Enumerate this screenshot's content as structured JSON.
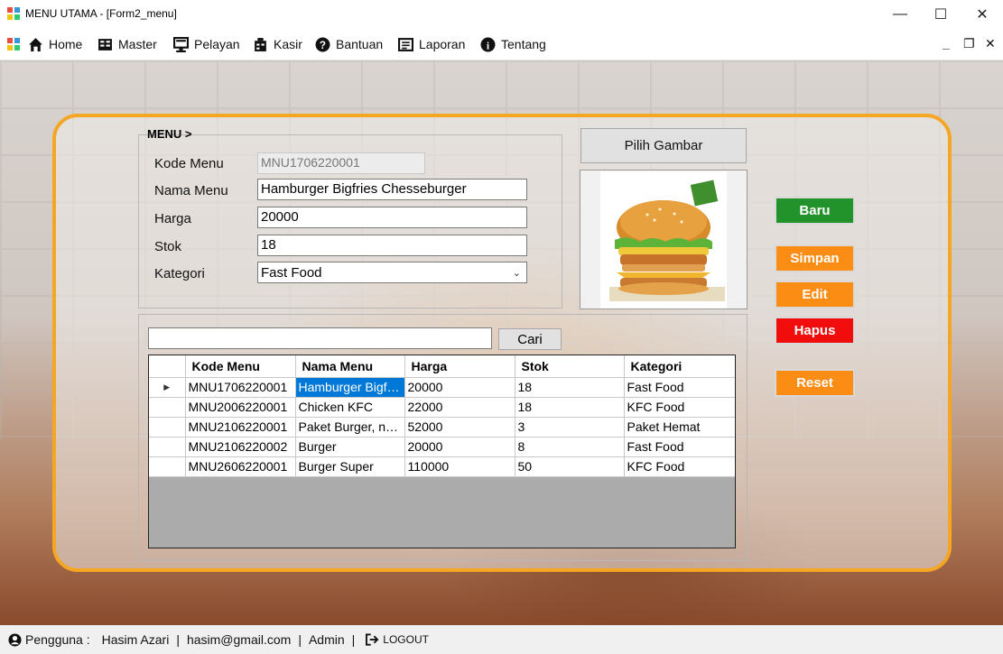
{
  "window": {
    "title": "MENU UTAMA - [Form2_menu]",
    "minimize": "—",
    "maximize": "☐",
    "close": "✕"
  },
  "menubar": {
    "items": [
      {
        "label": "Home",
        "icon": "home-icon"
      },
      {
        "label": "Master",
        "icon": "master-icon"
      },
      {
        "label": "Pelayan",
        "icon": "pelayan-icon"
      },
      {
        "label": "Kasir",
        "icon": "kasir-icon"
      },
      {
        "label": "Bantuan",
        "icon": "help-icon"
      },
      {
        "label": "Laporan",
        "icon": "report-icon"
      },
      {
        "label": "Tentang",
        "icon": "info-icon"
      }
    ],
    "mdi_minimize": "_",
    "mdi_restore": "❐",
    "mdi_close": "✕"
  },
  "form": {
    "group_title": "MENU >",
    "kode_label": "Kode Menu",
    "kode_value": "MNU1706220001",
    "nama_label": "Nama Menu",
    "nama_value": "Hamburger Bigfries Chesseburger",
    "harga_label": "Harga",
    "harga_value": "20000",
    "stok_label": "Stok",
    "stok_value": "18",
    "kategori_label": "Kategori",
    "kategori_value": "Fast Food"
  },
  "image": {
    "pilih_label": "Pilih Gambar"
  },
  "actions": {
    "baru": "Baru",
    "simpan": "Simpan",
    "edit": "Edit",
    "hapus": "Hapus",
    "reset": "Reset",
    "colors": {
      "baru": "#22922a",
      "simpan": "#fb8c14",
      "edit": "#fb8c14",
      "hapus": "#f20d0d",
      "reset": "#fb8c14"
    }
  },
  "search": {
    "value": "",
    "button": "Cari"
  },
  "grid": {
    "columns": [
      "Kode Menu",
      "Nama Menu",
      "Harga",
      "Stok",
      "Kategori"
    ],
    "rows": [
      [
        "MNU1706220001",
        "Hamburger Bigfri...",
        "20000",
        "18",
        "Fast Food"
      ],
      [
        "MNU2006220001",
        "Chicken KFC",
        "22000",
        "18",
        "KFC Food"
      ],
      [
        "MNU2106220001",
        "Paket Burger, nu...",
        "52000",
        "3",
        "Paket Hemat"
      ],
      [
        "MNU2106220002",
        "Burger",
        "20000",
        "8",
        "Fast Food"
      ],
      [
        "MNU2606220001",
        "Burger Super",
        "110000",
        "50",
        "KFC Food"
      ]
    ],
    "current_row_marker": "▶"
  },
  "status": {
    "pengguna_label": "Pengguna :",
    "user_name": "Hasim Azari",
    "email": "hasim@gmail.com",
    "role": "Admin",
    "logout": "LOGOUT",
    "sep": "|"
  }
}
